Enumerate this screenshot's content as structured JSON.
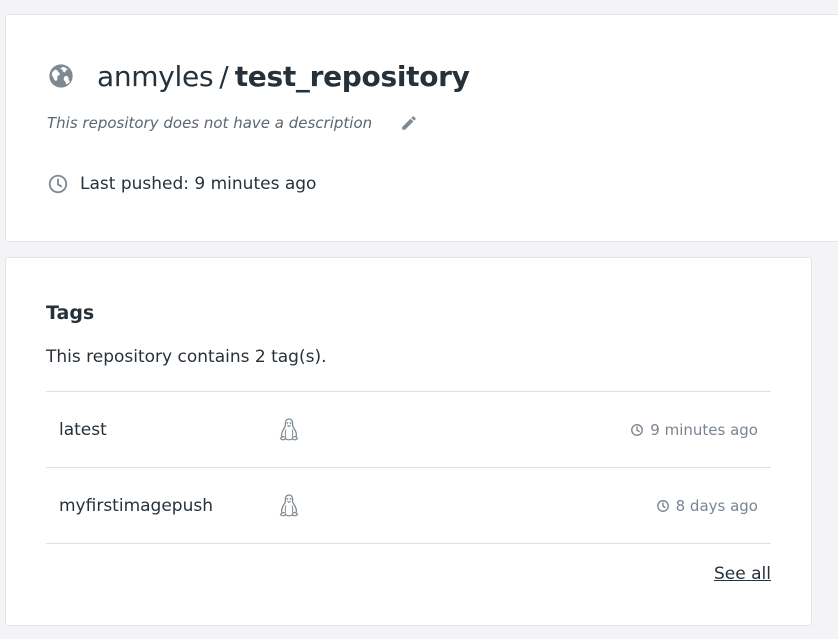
{
  "repo": {
    "owner": "anmyles",
    "separator": "/",
    "name": "test_repository",
    "description": "This repository does not have a description",
    "last_pushed": "Last pushed: 9 minutes ago",
    "visibility_icon": "globe-icon",
    "edit_icon": "pencil-icon"
  },
  "tags": {
    "heading": "Tags",
    "count_text": "This repository contains 2 tag(s).",
    "items": [
      {
        "name": "latest",
        "os_icon": "linux-icon",
        "pushed": "9 minutes ago"
      },
      {
        "name": "myfirstimagepush",
        "os_icon": "linux-icon",
        "pushed": "8 days ago"
      }
    ],
    "see_all": "See all"
  },
  "colors": {
    "text": "#27313a",
    "muted": "#7a8591",
    "icon": "#7d8a94",
    "border": "#dfe1e5",
    "background": "#f4f4f6"
  }
}
